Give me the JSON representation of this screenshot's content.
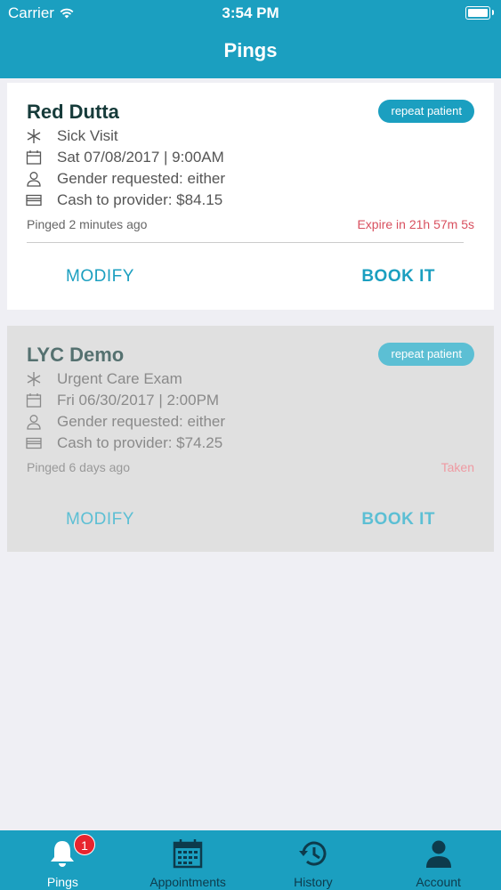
{
  "status_bar": {
    "carrier": "Carrier",
    "time": "3:54 PM"
  },
  "nav": {
    "title": "Pings"
  },
  "pings": [
    {
      "name": "Red Dutta",
      "badge": "repeat patient",
      "visit_type": "Sick Visit",
      "datetime": "Sat 07/08/2017 | 9:00AM",
      "gender": "Gender requested: either",
      "payment": "Cash to provider: $84.15",
      "pinged": "Pinged 2 minutes ago",
      "status": "Expire in 21h 57m 5s",
      "modify_label": "MODIFY",
      "book_label": "BOOK IT"
    },
    {
      "name": "LYC Demo",
      "badge": "repeat patient",
      "visit_type": "Urgent Care Exam",
      "datetime": "Fri 06/30/2017 | 2:00PM",
      "gender": "Gender requested: either",
      "payment": "Cash to provider: $74.25",
      "pinged": "Pinged 6 days ago",
      "status": "Taken",
      "modify_label": "MODIFY",
      "book_label": "BOOK IT"
    }
  ],
  "tabbar": {
    "pings": {
      "label": "Pings",
      "badge": "1",
      "icon": "bell-icon"
    },
    "appointments": {
      "label": "Appointments",
      "icon": "calendar-icon"
    },
    "history": {
      "label": "History",
      "icon": "history-icon"
    },
    "account": {
      "label": "Account",
      "icon": "person-icon"
    }
  },
  "colors": {
    "primary": "#1b9fc0",
    "expire": "#d8505f",
    "tab_badge": "#e8242e"
  }
}
